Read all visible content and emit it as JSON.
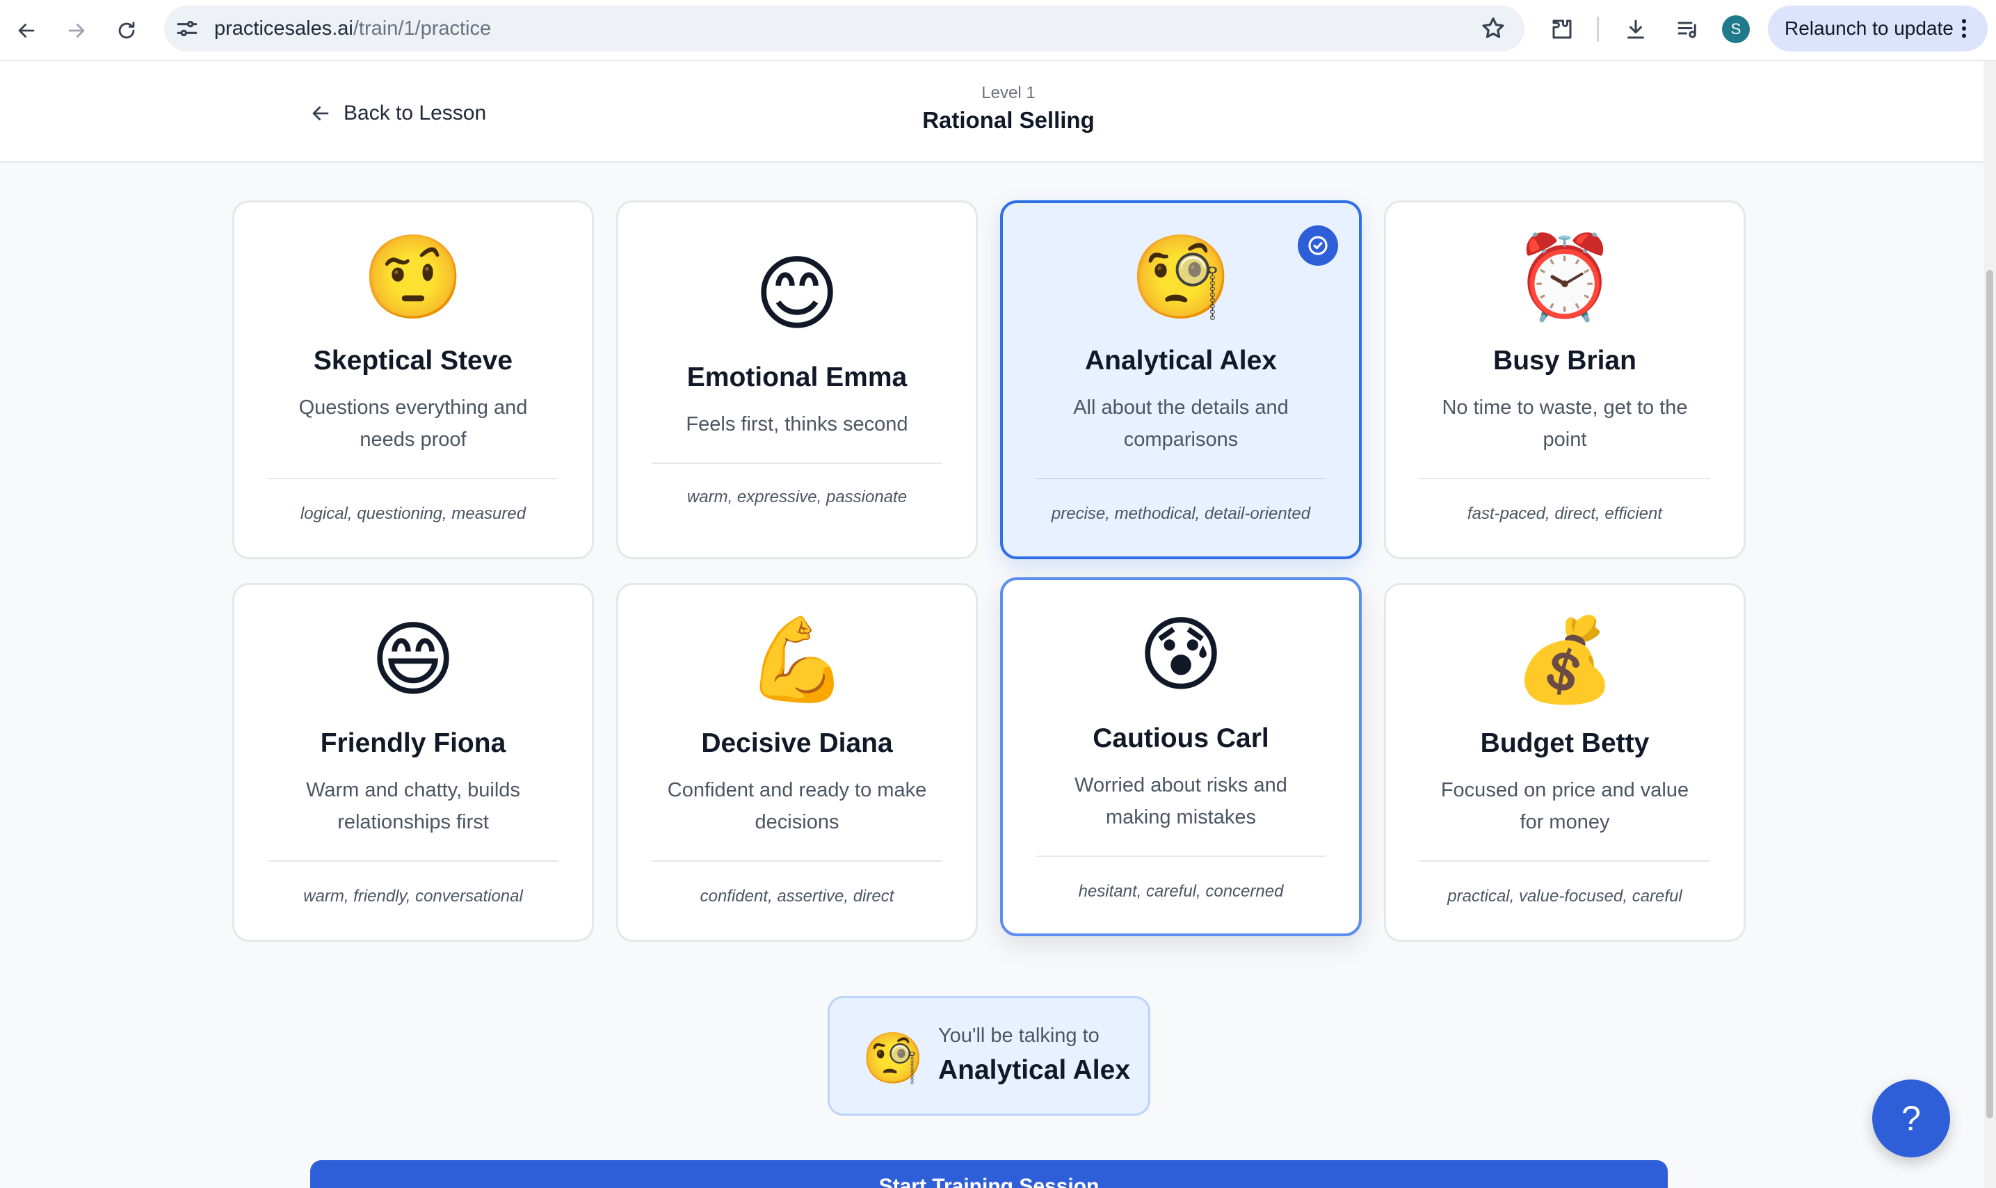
{
  "browser": {
    "url_host": "practicesales.ai",
    "url_path": "/train/1/practice",
    "avatar_letter": "S",
    "relaunch_label": "Relaunch to update"
  },
  "header": {
    "back_label": "Back to Lesson",
    "level": "Level 1",
    "title": "Rational Selling"
  },
  "personas": [
    {
      "emoji": "🤨",
      "name": "Skeptical Steve",
      "description": "Questions everything and needs proof",
      "traits": "logical, questioning, measured"
    },
    {
      "emoji": "😊",
      "name": "Emotional Emma",
      "description": "Feels first, thinks second",
      "traits": "warm, expressive, passionate"
    },
    {
      "emoji": "🧐",
      "name": "Analytical Alex",
      "description": "All about the details and comparisons",
      "traits": "precise, methodical, detail-oriented",
      "selected": true
    },
    {
      "emoji": "⏰",
      "name": "Busy Brian",
      "description": "No time to waste, get to the point",
      "traits": "fast-paced, direct, efficient"
    },
    {
      "emoji": "😄",
      "name": "Friendly Fiona",
      "description": "Warm and chatty, builds relationships first",
      "traits": "warm, friendly, conversational"
    },
    {
      "emoji": "💪",
      "name": "Decisive Diana",
      "description": "Confident and ready to make decisions",
      "traits": "confident, assertive, direct"
    },
    {
      "emoji": "😰",
      "name": "Cautious Carl",
      "description": "Worried about risks and making mistakes",
      "traits": "hesitant, careful, concerned"
    },
    {
      "emoji": "💰",
      "name": "Budget Betty",
      "description": "Focused on price and value for money",
      "traits": "practical, value-focused, careful"
    }
  ],
  "talking_to": {
    "prefix": "You'll be talking to",
    "emoji": "🧐",
    "name": "Analytical Alex"
  },
  "start_button_label": "Start Training Session",
  "help_label": "?",
  "colors": {
    "primary": "#2f5fd8",
    "selected_bg": "#e8f1ff",
    "selected_border": "#2f6fe4"
  }
}
